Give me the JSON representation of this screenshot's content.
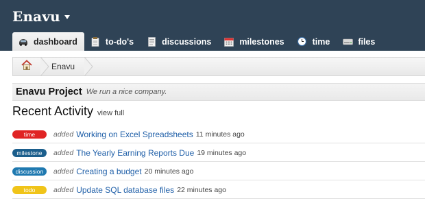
{
  "header": {
    "brand": "Enavu",
    "bg_color": "#2f4356"
  },
  "tabs": [
    {
      "label": "dashboard",
      "icon": "car-icon",
      "active": true
    },
    {
      "label": "to-do's",
      "icon": "notepad-icon",
      "active": false
    },
    {
      "label": "discussions",
      "icon": "document-icon",
      "active": false
    },
    {
      "label": "milestones",
      "icon": "calendar-icon",
      "active": false
    },
    {
      "label": "time",
      "icon": "clock-icon",
      "active": false
    },
    {
      "label": "files",
      "icon": "drive-icon",
      "active": false
    }
  ],
  "breadcrumb": {
    "home_icon": "home-icon",
    "current": "Enavu"
  },
  "project": {
    "name": "Enavu Project",
    "tagline": "We run a nice company."
  },
  "recent_activity": {
    "title": "Recent Activity",
    "view_full": "view full",
    "items": [
      {
        "badge": "time",
        "badge_color": "#e02424",
        "verb": "added",
        "title": "Working on Excel Spreadsheets",
        "ago": "11 minutes ago"
      },
      {
        "badge": "milestone",
        "badge_color": "#1b5e8c",
        "verb": "added",
        "title": "The Yearly Earning Reports Due",
        "ago": "19 minutes ago"
      },
      {
        "badge": "discussion",
        "badge_color": "#1f79b0",
        "verb": "added",
        "title": "Creating a budget",
        "ago": "20 minutes ago"
      },
      {
        "badge": "todo",
        "badge_color": "#f0c419",
        "verb": "added",
        "title": "Update SQL database files",
        "ago": "22 minutes ago"
      }
    ]
  }
}
